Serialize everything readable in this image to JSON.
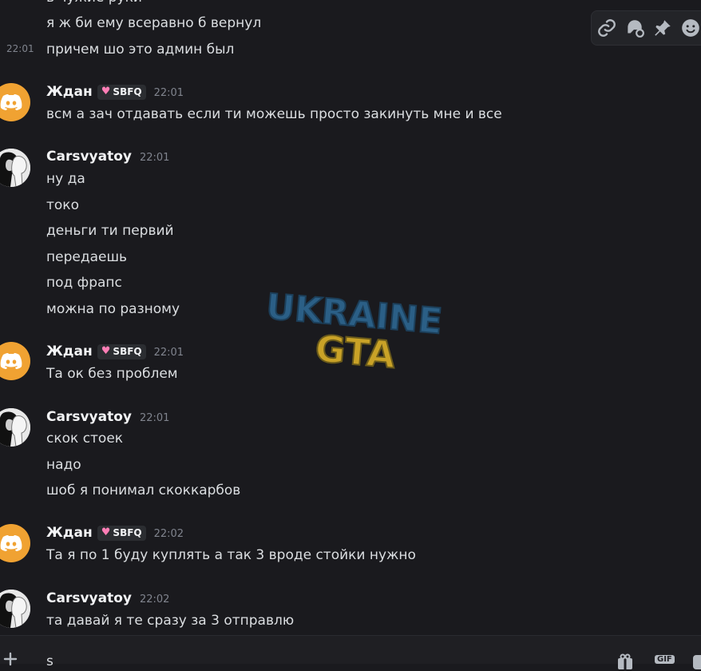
{
  "messages": {
    "top_partial": "в чужие руки",
    "top_line2": "я ж би ему всеравно б вернул",
    "top_ts": "22:01",
    "top_line3": "причем шо это админ был",
    "g1": {
      "author": "Ждан",
      "tag": "SBFQ",
      "time": "22:01",
      "lines": [
        "всм а зач отдавать если ти можешь просто закинуть мне и все"
      ]
    },
    "g2": {
      "author": "Carsvyatoy",
      "time": "22:01",
      "lines": [
        "ну да",
        "токо",
        "деньги ти первий",
        "передаешь",
        "под фрапс",
        "можна по разному"
      ]
    },
    "g3": {
      "author": "Ждан",
      "tag": "SBFQ",
      "time": "22:01",
      "lines": [
        "Та ок без проблем"
      ]
    },
    "g4": {
      "author": "Carsvyatoy",
      "time": "22:01",
      "lines": [
        "скок стоек",
        "надо",
        "шоб я понимал скоккарбов"
      ]
    },
    "g5": {
      "author": "Ждан",
      "tag": "SBFQ",
      "time": "22:02",
      "lines": [
        "Та я по 1 буду куплять а так 3 вроде стойки нужно"
      ]
    },
    "g6": {
      "author": "Carsvyatoy",
      "time": "22:02",
      "lines": [
        "та давай я те сразу за 3 отправлю"
      ]
    }
  },
  "toolbar": {
    "icons": [
      "link-icon",
      "reply-thread-icon",
      "pin-icon",
      "emoji-icon"
    ]
  },
  "watermark": {
    "line1": "UKRAINE",
    "line2": "GTA"
  },
  "composer": {
    "text": "s",
    "icons": [
      "add-icon",
      "gift-icon",
      "gif-icon",
      "sticker-icon"
    ],
    "gif_label": "GIF"
  },
  "colors": {
    "bg": "#1a1a1e",
    "discord_orange": "#f0a232",
    "tag_heart": "#ff7eb6",
    "watermark_blue": "#2b5f86",
    "watermark_yellow": "#c9a227"
  }
}
